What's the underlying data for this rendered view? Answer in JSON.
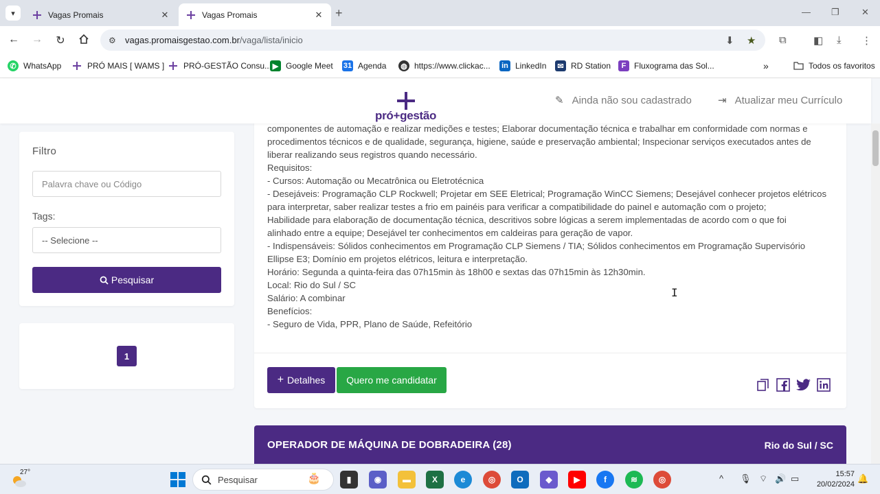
{
  "browser": {
    "tabs": [
      {
        "title": "Vagas Promais",
        "active": false
      },
      {
        "title": "Vagas Promais",
        "active": true
      }
    ],
    "url_host": "vagas.promaisgestao.com.br",
    "url_path": "/vaga/lista/inicio",
    "bookmarks": [
      {
        "label": "WhatsApp",
        "icon": "whatsapp-icon",
        "color": "#25d366"
      },
      {
        "label": "PRÓ MAIS [ WAMS ]",
        "icon": "promais-icon",
        "color": "#4b2a83"
      },
      {
        "label": "PRÓ-GESTÃO Consu...",
        "icon": "promais-icon",
        "color": "#4b2a83"
      },
      {
        "label": "Google Meet",
        "icon": "meet-icon",
        "color": "#00832d"
      },
      {
        "label": "Agenda",
        "icon": "calendar-icon",
        "color": "#1a73e8"
      },
      {
        "label": "https://www.clickac...",
        "icon": "globe-icon",
        "color": "#333333"
      },
      {
        "label": "LinkedIn",
        "icon": "linkedin-icon",
        "color": "#0a66c2"
      },
      {
        "label": "RD Station",
        "icon": "rdstation-icon",
        "color": "#1d3b6f"
      },
      {
        "label": "Fluxograma das Sol...",
        "icon": "fluxograma-icon",
        "color": "#7b3fbf"
      }
    ],
    "all_favorites": "Todos os favoritos"
  },
  "site": {
    "logo_text": "pró+gestão",
    "register_link": "Ainda não sou cadastrado",
    "update_cv_link": "Atualizar meu Currículo"
  },
  "filter": {
    "title": "Filtro",
    "keyword_placeholder": "Palavra chave ou Código",
    "tags_label": "Tags:",
    "tags_select": "-- Selecione --",
    "search_button": "Pesquisar"
  },
  "pagination": {
    "current_page": "1"
  },
  "job": {
    "description_lines": [
      "componentes de automação e realizar medições e testes; Elaborar documentação técnica e trabalhar em conformidade com normas e",
      "procedimentos técnicos e de qualidade, segurança, higiene, saúde e preservação ambiental; Inspecionar serviços executados antes de",
      "liberar realizando seus registros quando necessário.",
      "Requisitos:",
      "- Cursos: Automação ou Mecatrônica ou Eletrotécnica",
      "- Desejáveis: Programação CLP Rockwell; Projetar em SEE Eletrical; Programação WinCC Siemens; Desejável conhecer projetos elétricos",
      "para interpretar, saber realizar testes a frio em painéis para verificar a compatibilidade do painel e automação com o projeto;",
      "Habilidade para elaboração de documentação técnica, descritivos sobre lógicas a serem implementadas de acordo com o que foi",
      "alinhado entre a equipe; Desejável ter conhecimentos em caldeiras para geração de vapor.",
      "- Indispensáveis: Sólidos conhecimentos em Programação CLP Siemens / TIA; Sólidos conhecimentos em Programação Supervisório",
      "Ellipse E3; Domínio em projetos elétricos, leitura e interpretação.",
      "Horário: Segunda a quinta-feira das 07h15min às 18h00 e sextas das 07h15min às 12h30min.",
      "Local: Rio do Sul / SC",
      "Salário: A combinar",
      "Benefícios:",
      "- Seguro de Vida, PPR, Plano de Saúde, Refeitório"
    ],
    "details_button": "Detalhes",
    "apply_button": "Quero me candidatar"
  },
  "next_job": {
    "title": "OPERADOR DE MÁQUINA DE DOBRADEIRA (28)",
    "location": "Rio do Sul / SC"
  },
  "taskbar": {
    "temperature": "27°",
    "search_placeholder": "Pesquisar",
    "time": "15:57",
    "date": "20/02/2024"
  },
  "colors": {
    "brand": "#4b2a83",
    "apply": "#28a745"
  }
}
